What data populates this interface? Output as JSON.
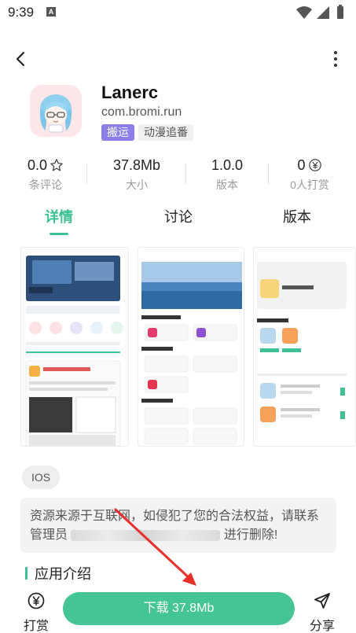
{
  "status_bar": {
    "time": "9:39",
    "notification_letter": "A"
  },
  "app": {
    "name": "Lanerc",
    "package": "com.bromi.run",
    "tags": [
      "搬运",
      "动漫追番"
    ]
  },
  "stats": [
    {
      "value": "0.0",
      "label": "条评论",
      "icon": "star-outline-icon"
    },
    {
      "value": "37.8Mb",
      "label": "大小"
    },
    {
      "value": "1.0.0",
      "label": "版本"
    },
    {
      "value": "0",
      "label": "0人打赏",
      "icon": "yuan-coin-icon"
    }
  ],
  "tabs": [
    "详情",
    "讨论",
    "版本"
  ],
  "active_tab": 0,
  "platform": "IOS",
  "notice": {
    "line1": "资源来源于互联网，如侵犯了您的合法权益，请联系",
    "line2_start": "管理员",
    "line2_end": "进行删除!"
  },
  "section": {
    "title": "应用介绍"
  },
  "bottom": {
    "tip_label": "打赏",
    "download_label": "下载 37.8Mb",
    "share_label": "分享"
  },
  "colors": {
    "accent": "#3cc194",
    "tag_purple": "#8c7ee8",
    "arrow_red": "#e8302a"
  }
}
